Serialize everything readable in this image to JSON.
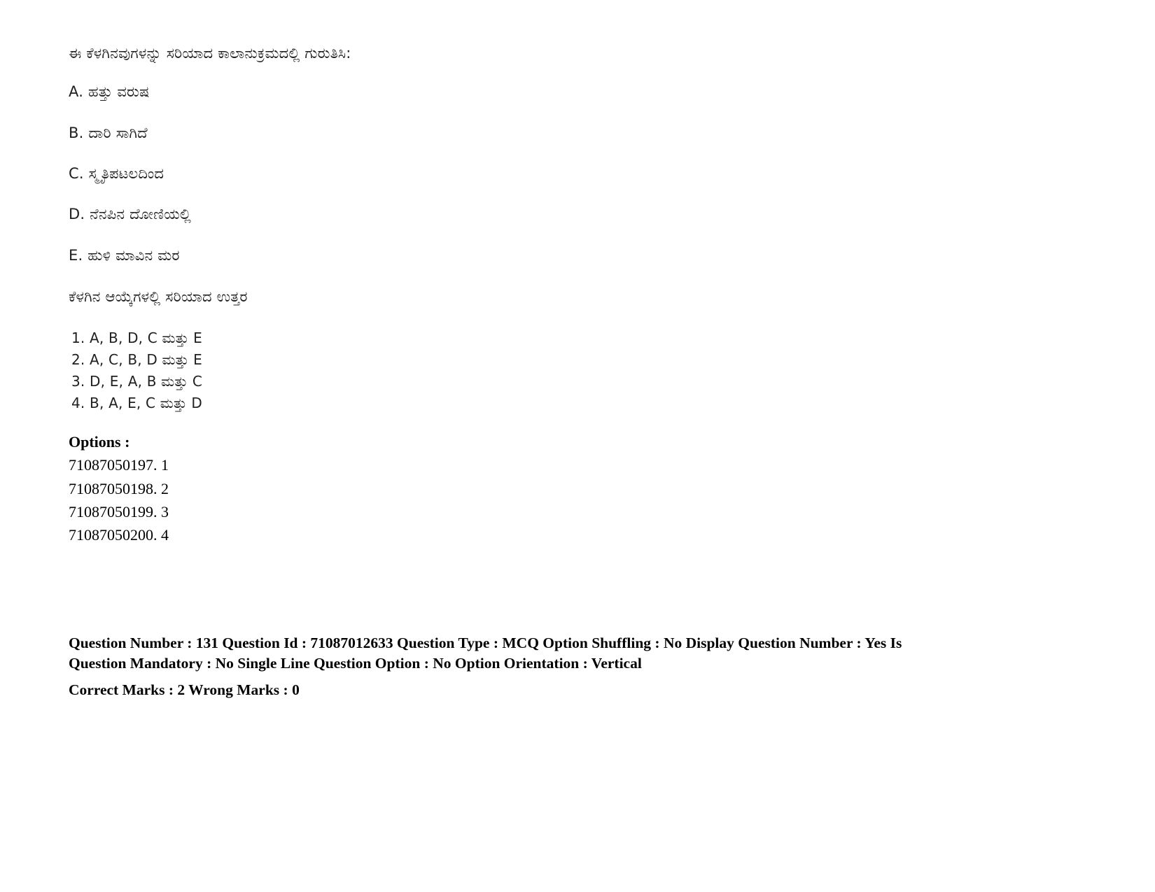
{
  "document": {
    "language": "Kannada",
    "stem": "ಈ ಕೆಳಗಿನವುಗಳನ್ನು ಸರಿಯಾದ ಕಾಲಾನುಕ್ರಮದಲ್ಲಿ ಗುರುತಿಸಿ:",
    "items": [
      "A. ಹತ್ತು ವರುಷ",
      "B. ದಾರಿ ಸಾಗಿದೆ",
      "C. ಸ್ಮೃತಿಪಟಲದಿಂದ",
      "D. ನೆನಪಿನ ದೋಣಿಯಲ್ಲಿ",
      "E. ಹುಳಿ ಮಾವಿನ ಮರ"
    ],
    "lead_in": "ಕೆಳಗಿನ ಆಯ್ಕೆಗಳಲ್ಲಿ ಸರಿಯಾದ ಉತ್ತರ",
    "choices": [
      "1. A, B, D, C ಮತ್ತು E",
      "2. A, C, B, D ಮತ್ತು E",
      "3. D, E, A, B ಮತ್ತು C",
      "4. B, A, E, C ಮತ್ತು D"
    ]
  },
  "options": {
    "heading": "Options :",
    "entries": [
      "71087050197. 1",
      "71087050198. 2",
      "71087050199. 3",
      "71087050200. 4"
    ]
  },
  "metadata": {
    "line1": "Question Number : 131 Question Id : 71087012633 Question Type : MCQ Option Shuffling : No Display Question Number : Yes Is",
    "line2": "Question Mandatory : No Single Line Question Option : No Option Orientation : Vertical",
    "line3": "Correct Marks : 2 Wrong Marks : 0"
  }
}
